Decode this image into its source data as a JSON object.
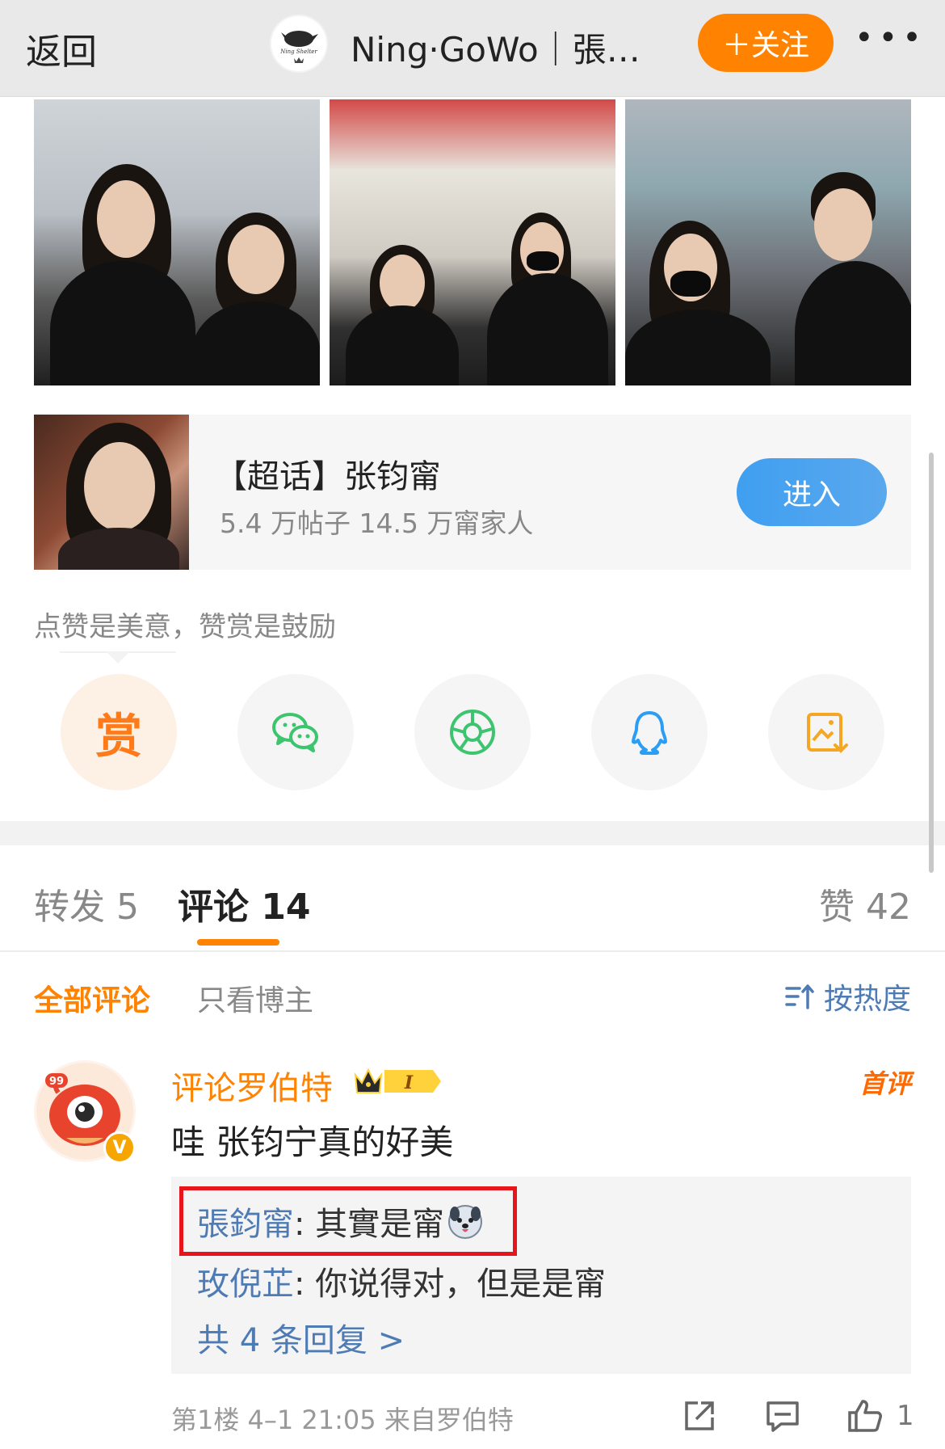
{
  "header": {
    "back_label": "返回",
    "title": "Ning·GoWo｜張…",
    "follow_label": "＋关注",
    "more_label": "•••"
  },
  "supertopic": {
    "title": "【超话】张钧甯",
    "stats": "5.4 万帖子 14.5 万甯家人",
    "enter_label": "进入"
  },
  "reward": {
    "tip": "点赞是美意，赞赏是鼓励",
    "reward_glyph": "赏"
  },
  "share_icons": [
    "reward-icon",
    "wechat-icon",
    "moments-icon",
    "qq-icon",
    "save-image-icon"
  ],
  "tabs": {
    "repost": "转发 5",
    "comment": "评论 14",
    "like": "赞 42"
  },
  "filters": {
    "all": "全部评论",
    "author_only": "只看博主",
    "sort": "按热度"
  },
  "comment": {
    "avatar_badge": "99",
    "verified_badge": "V",
    "username": "评论罗伯特",
    "first_badge": "首评",
    "text": "哇 张钧宁真的好美",
    "replies": [
      {
        "name": "張鈞甯",
        "text": ": 其實是甯"
      },
      {
        "name": "玫倪芷",
        "text": ": 你说得对，但是是甯"
      }
    ],
    "more_replies": "共 4 条回复 >",
    "meta": "第1楼 4–1 21:05 来自罗伯特",
    "like_count": "1"
  },
  "colors": {
    "accent_orange": "#ff8200",
    "link_blue": "#4e7bb4",
    "enter_blue": "#3f9ff0",
    "highlight_red": "#e8141b"
  }
}
